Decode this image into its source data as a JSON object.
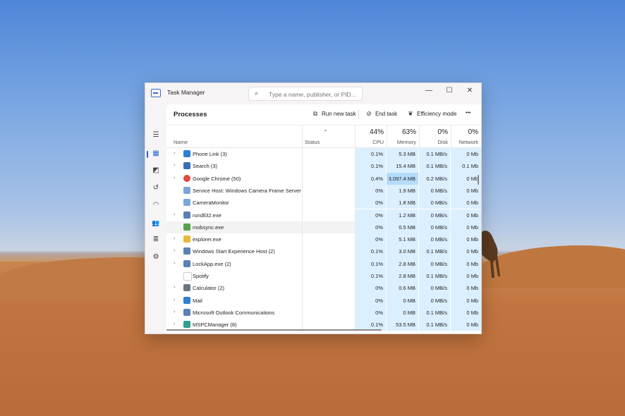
{
  "window": {
    "title": "Task Manager",
    "search_placeholder": "Type a name, publisher, or PID...",
    "controls": [
      "—",
      "☐",
      "✕"
    ]
  },
  "nav": {
    "items": [
      {
        "name": "hamburger-icon",
        "glyph": "☰"
      },
      {
        "name": "processes-icon",
        "glyph": "▦"
      },
      {
        "name": "performance-icon",
        "glyph": "◩"
      },
      {
        "name": "app-history-icon",
        "glyph": "↺"
      },
      {
        "name": "startup-apps-icon",
        "glyph": "◠"
      },
      {
        "name": "users-icon",
        "glyph": "👥"
      },
      {
        "name": "details-icon",
        "glyph": "≣"
      },
      {
        "name": "services-icon",
        "glyph": "⚙"
      }
    ],
    "settings_glyph": "⚙"
  },
  "toolbar": {
    "title": "Processes",
    "run_new_task": "Run new task",
    "end_task": "End task",
    "efficiency_mode": "Efficiency mode",
    "more": "•••"
  },
  "columns": {
    "name": "Name",
    "status": "Status",
    "cpu": {
      "percent": "44%",
      "label": "CPU"
    },
    "memory": {
      "percent": "63%",
      "label": "Memory"
    },
    "disk": {
      "percent": "0%",
      "label": "Disk"
    },
    "network": {
      "percent": "0%",
      "label": "Network"
    }
  },
  "colors": {
    "accent": "#2a67c9",
    "heat": "#dcefff",
    "heat_hot": "#b4dcfb"
  },
  "processes": [
    {
      "name": "Phone Link (3)",
      "expand": true,
      "icon": "phone-link-icon",
      "color": "#2f7fd6",
      "cpu": "0.1%",
      "memory": "5.3 MB",
      "disk": "0.1 MB/s",
      "network": "0 Mb"
    },
    {
      "name": "Search (3)",
      "expand": true,
      "icon": "search-app-icon",
      "color": "#3a6db8",
      "cpu": "0.1%",
      "memory": "15.4 MB",
      "disk": "0.1 MB/s",
      "network": "0.1 Mb"
    },
    {
      "name": "Google Chrome (50)",
      "expand": true,
      "icon": "chrome-icon",
      "color": "#e3483b",
      "cpu": "0.4%",
      "memory": "3,097.4 MB",
      "disk": "0.2 MB/s",
      "network": "0 Mb",
      "hot": true
    },
    {
      "name": "Service Host: Windows Camera Frame Server",
      "expand": false,
      "icon": "service-host-icon",
      "color": "#7aa6d9",
      "cpu": "0%",
      "memory": "1.9 MB",
      "disk": "0 MB/s",
      "network": "0 Mb"
    },
    {
      "name": "CameraMonitor",
      "expand": false,
      "icon": "camera-monitor-icon",
      "color": "#7aa6d9",
      "cpu": "0%",
      "memory": "1.8 MB",
      "disk": "0 MB/s",
      "network": "0 Mb"
    },
    {
      "name": "rundll32.exe",
      "expand": true,
      "icon": "rundll-icon",
      "color": "#5d7fb3",
      "cpu": "0%",
      "memory": "1.2 MB",
      "disk": "0 MB/s",
      "network": "0 Mb"
    },
    {
      "name": "mobsync.exe",
      "expand": false,
      "icon": "mobsync-icon",
      "color": "#57a24a",
      "cpu": "0%",
      "memory": "0.5 MB",
      "disk": "0 MB/s",
      "network": "0 Mb",
      "highlight": true
    },
    {
      "name": "explorer.exe",
      "expand": true,
      "icon": "folder-icon",
      "color": "#e7b93a",
      "cpu": "0%",
      "memory": "5.1 MB",
      "disk": "0 MB/s",
      "network": "0 Mb"
    },
    {
      "name": "Windows Start Experience Host (2)",
      "expand": true,
      "icon": "start-host-icon",
      "color": "#5d7fb3",
      "cpu": "0.1%",
      "memory": "3.0 MB",
      "disk": "0.1 MB/s",
      "network": "0 Mb"
    },
    {
      "name": "LockApp.exe (2)",
      "expand": true,
      "icon": "lockapp-icon",
      "color": "#5d7fb3",
      "cpu": "0.1%",
      "memory": "2.8 MB",
      "disk": "0 MB/s",
      "network": "0 Mb"
    },
    {
      "name": "Spotify",
      "expand": false,
      "icon": "spotify-icon",
      "color": "#ffffff",
      "cpu": "0.1%",
      "memory": "2.8 MB",
      "disk": "0.1 MB/s",
      "network": "0 Mb"
    },
    {
      "name": "Calculator (2)",
      "expand": true,
      "icon": "calculator-icon",
      "color": "#6b7587",
      "cpu": "0%",
      "memory": "0.6 MB",
      "disk": "0 MB/s",
      "network": "0 Mb"
    },
    {
      "name": "Mail",
      "expand": true,
      "icon": "mail-icon",
      "color": "#2f7fd6",
      "cpu": "0%",
      "memory": "0 MB",
      "disk": "0 MB/s",
      "network": "0 Mb"
    },
    {
      "name": "Microsoft Outlook Communications",
      "expand": true,
      "icon": "outlook-icon",
      "color": "#5d7fb3",
      "cpu": "0%",
      "memory": "0 MB",
      "disk": "0.1 MB/s",
      "network": "0 Mb"
    },
    {
      "name": "MSPCManager (8)",
      "expand": true,
      "icon": "pc-manager-icon",
      "color": "#2fa08f",
      "cpu": "0.1%",
      "memory": "53.5 MB",
      "disk": "0.1 MB/s",
      "network": "0 Mb"
    }
  ]
}
